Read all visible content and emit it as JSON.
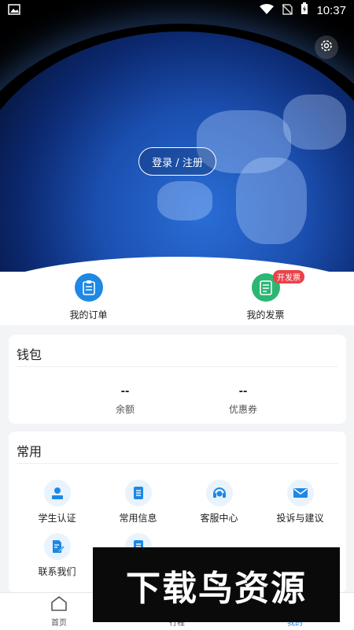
{
  "status_bar": {
    "time": "10:37",
    "icons": [
      "image-icon",
      "wifi-icon",
      "no-sim-icon",
      "battery-charging-icon"
    ]
  },
  "hero": {
    "login_label": "登录 / 注册"
  },
  "quick_actions": [
    {
      "label": "我的订单",
      "icon": "clipboard-icon",
      "color": "#1e88e5"
    },
    {
      "label": "我的发票",
      "icon": "invoice-icon",
      "color": "#2bb673",
      "badge": "开发票"
    }
  ],
  "wallet": {
    "title": "钱包",
    "items": [
      {
        "value": "--",
        "label": "余额"
      },
      {
        "value": "--",
        "label": "优惠券"
      }
    ]
  },
  "common": {
    "title": "常用",
    "items": [
      {
        "label": "学生认证",
        "icon": "user-id-icon"
      },
      {
        "label": "常用信息",
        "icon": "list-doc-icon"
      },
      {
        "label": "客服中心",
        "icon": "headset-icon"
      },
      {
        "label": "投诉与建议",
        "icon": "mail-icon"
      },
      {
        "label": "联系我们",
        "icon": "edit-doc-icon"
      },
      {
        "label": "",
        "icon": "doc-icon"
      }
    ]
  },
  "tabbar": [
    {
      "label": "首页",
      "icon": "home-icon",
      "active": false
    },
    {
      "label": "行程",
      "icon": "trip-icon",
      "active": false
    },
    {
      "label": "我的",
      "icon": "profile-icon",
      "active": true
    }
  ],
  "watermark": {
    "text": "下载鸟资源"
  },
  "colors": {
    "accent": "#1e88e5",
    "icon_bg": "#e8f3fd",
    "badge": "#e8434a"
  }
}
